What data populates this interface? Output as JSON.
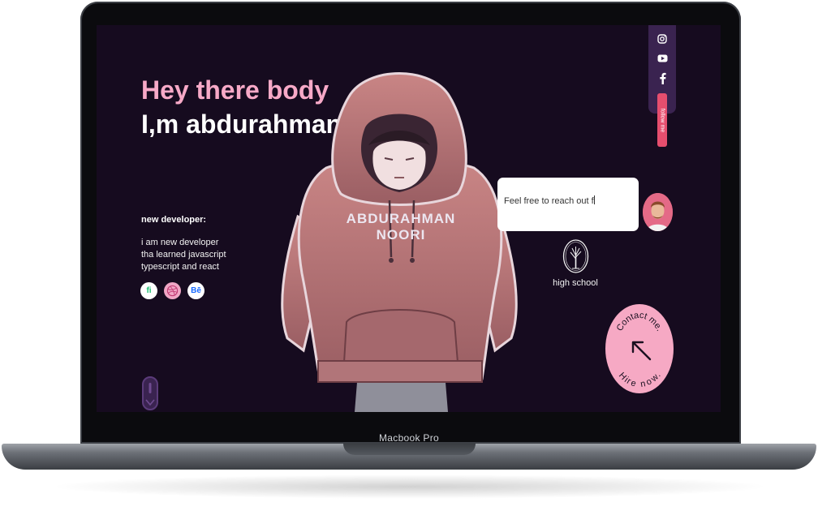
{
  "device": {
    "label": "Macbook Pro"
  },
  "hero": {
    "greeting_line1": "Hey there body",
    "greeting_line2": "I,m abdurahman",
    "role": "new developer:",
    "bio": [
      "i am new developer",
      "tha learned javascript",
      "typescript and react"
    ],
    "illustration_name_line1": "ABDURAHMAN",
    "illustration_name_line2": "NOORI"
  },
  "social_links": [
    {
      "name": "fiverr-icon",
      "glyph": "fi",
      "bg": "#ffffff",
      "fg": "#1dbf73"
    },
    {
      "name": "dribbble-icon",
      "glyph": "⊛",
      "bg": "#f0a6c5",
      "fg": "#ea4c89"
    },
    {
      "name": "behance-icon",
      "glyph": "Bē",
      "bg": "#ffffff",
      "fg": "#1769ff"
    }
  ],
  "follow": {
    "label": "follow me",
    "icons": [
      "instagram-icon",
      "youtube-icon",
      "facebook-icon"
    ]
  },
  "chat": {
    "input_value": "Feel free to reach out f"
  },
  "education": {
    "label": "high school"
  },
  "contact": {
    "text_top": "Contact me.",
    "text_bottom": "Hire now."
  },
  "colors": {
    "screen_bg": "#160b1f",
    "accent_pink": "#f7a9c7",
    "follow_panel": "#3a2350",
    "follow_tab": "#e64e6e",
    "contact_bg": "#f6a9c4"
  }
}
